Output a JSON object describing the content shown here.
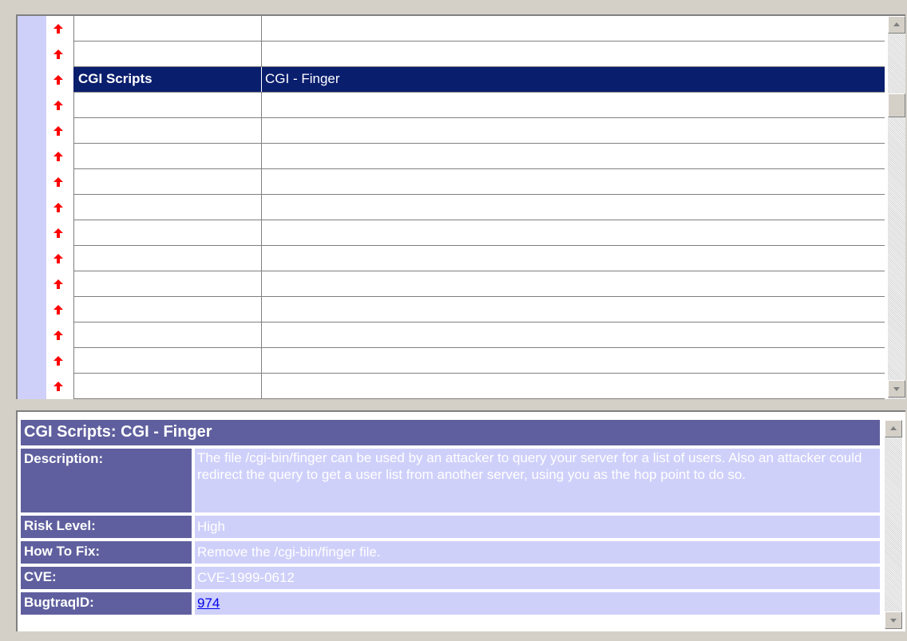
{
  "results": {
    "row_count": 15,
    "selected_row": 2,
    "row_icon": "red-up-arrow-icon",
    "rows": [
      {
        "category": "",
        "name": ""
      },
      {
        "category": "",
        "name": ""
      },
      {
        "category": "CGI Scripts",
        "name": "CGI - Finger"
      },
      {
        "category": "",
        "name": ""
      },
      {
        "category": "",
        "name": ""
      },
      {
        "category": "",
        "name": ""
      },
      {
        "category": "",
        "name": ""
      },
      {
        "category": "",
        "name": ""
      },
      {
        "category": "",
        "name": ""
      },
      {
        "category": "",
        "name": ""
      },
      {
        "category": "",
        "name": ""
      },
      {
        "category": "",
        "name": ""
      },
      {
        "category": "",
        "name": ""
      },
      {
        "category": "",
        "name": ""
      },
      {
        "category": "",
        "name": ""
      }
    ]
  },
  "details": {
    "title": "CGI Scripts: CGI - Finger",
    "description_label": "Description:",
    "description": "The file /cgi-bin/finger can be used by an attacker to query your server for a list of users. Also an attacker could redirect the query to get a user list from another server, using you as the hop point to do so.",
    "risk_label": "Risk Level:",
    "risk": "High",
    "fix_label": "How To Fix:",
    "fix": "Remove the /cgi-bin/finger file.",
    "cve_label": "CVE:",
    "cve": "CVE-1999-0612",
    "bugtraq_label": "BugtraqID:",
    "bugtraq": "974"
  },
  "colors": {
    "selection": "#0a1e6e",
    "header_bg": "#5f5f9f",
    "value_bg": "#cfd0fa",
    "icon": "#ff0000"
  }
}
